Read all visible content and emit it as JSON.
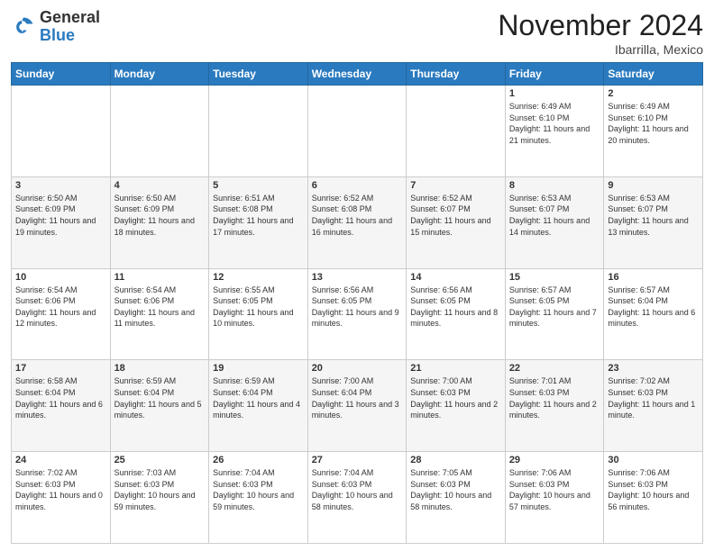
{
  "logo": {
    "general": "General",
    "blue": "Blue"
  },
  "header": {
    "month": "November 2024",
    "location": "Ibarrilla, Mexico"
  },
  "days_of_week": [
    "Sunday",
    "Monday",
    "Tuesday",
    "Wednesday",
    "Thursday",
    "Friday",
    "Saturday"
  ],
  "weeks": [
    [
      {
        "day": "",
        "sunrise": "",
        "sunset": "",
        "daylight": ""
      },
      {
        "day": "",
        "sunrise": "",
        "sunset": "",
        "daylight": ""
      },
      {
        "day": "",
        "sunrise": "",
        "sunset": "",
        "daylight": ""
      },
      {
        "day": "",
        "sunrise": "",
        "sunset": "",
        "daylight": ""
      },
      {
        "day": "",
        "sunrise": "",
        "sunset": "",
        "daylight": ""
      },
      {
        "day": "1",
        "sunrise": "Sunrise: 6:49 AM",
        "sunset": "Sunset: 6:10 PM",
        "daylight": "Daylight: 11 hours and 21 minutes."
      },
      {
        "day": "2",
        "sunrise": "Sunrise: 6:49 AM",
        "sunset": "Sunset: 6:10 PM",
        "daylight": "Daylight: 11 hours and 20 minutes."
      }
    ],
    [
      {
        "day": "3",
        "sunrise": "Sunrise: 6:50 AM",
        "sunset": "Sunset: 6:09 PM",
        "daylight": "Daylight: 11 hours and 19 minutes."
      },
      {
        "day": "4",
        "sunrise": "Sunrise: 6:50 AM",
        "sunset": "Sunset: 6:09 PM",
        "daylight": "Daylight: 11 hours and 18 minutes."
      },
      {
        "day": "5",
        "sunrise": "Sunrise: 6:51 AM",
        "sunset": "Sunset: 6:08 PM",
        "daylight": "Daylight: 11 hours and 17 minutes."
      },
      {
        "day": "6",
        "sunrise": "Sunrise: 6:52 AM",
        "sunset": "Sunset: 6:08 PM",
        "daylight": "Daylight: 11 hours and 16 minutes."
      },
      {
        "day": "7",
        "sunrise": "Sunrise: 6:52 AM",
        "sunset": "Sunset: 6:07 PM",
        "daylight": "Daylight: 11 hours and 15 minutes."
      },
      {
        "day": "8",
        "sunrise": "Sunrise: 6:53 AM",
        "sunset": "Sunset: 6:07 PM",
        "daylight": "Daylight: 11 hours and 14 minutes."
      },
      {
        "day": "9",
        "sunrise": "Sunrise: 6:53 AM",
        "sunset": "Sunset: 6:07 PM",
        "daylight": "Daylight: 11 hours and 13 minutes."
      }
    ],
    [
      {
        "day": "10",
        "sunrise": "Sunrise: 6:54 AM",
        "sunset": "Sunset: 6:06 PM",
        "daylight": "Daylight: 11 hours and 12 minutes."
      },
      {
        "day": "11",
        "sunrise": "Sunrise: 6:54 AM",
        "sunset": "Sunset: 6:06 PM",
        "daylight": "Daylight: 11 hours and 11 minutes."
      },
      {
        "day": "12",
        "sunrise": "Sunrise: 6:55 AM",
        "sunset": "Sunset: 6:05 PM",
        "daylight": "Daylight: 11 hours and 10 minutes."
      },
      {
        "day": "13",
        "sunrise": "Sunrise: 6:56 AM",
        "sunset": "Sunset: 6:05 PM",
        "daylight": "Daylight: 11 hours and 9 minutes."
      },
      {
        "day": "14",
        "sunrise": "Sunrise: 6:56 AM",
        "sunset": "Sunset: 6:05 PM",
        "daylight": "Daylight: 11 hours and 8 minutes."
      },
      {
        "day": "15",
        "sunrise": "Sunrise: 6:57 AM",
        "sunset": "Sunset: 6:05 PM",
        "daylight": "Daylight: 11 hours and 7 minutes."
      },
      {
        "day": "16",
        "sunrise": "Sunrise: 6:57 AM",
        "sunset": "Sunset: 6:04 PM",
        "daylight": "Daylight: 11 hours and 6 minutes."
      }
    ],
    [
      {
        "day": "17",
        "sunrise": "Sunrise: 6:58 AM",
        "sunset": "Sunset: 6:04 PM",
        "daylight": "Daylight: 11 hours and 6 minutes."
      },
      {
        "day": "18",
        "sunrise": "Sunrise: 6:59 AM",
        "sunset": "Sunset: 6:04 PM",
        "daylight": "Daylight: 11 hours and 5 minutes."
      },
      {
        "day": "19",
        "sunrise": "Sunrise: 6:59 AM",
        "sunset": "Sunset: 6:04 PM",
        "daylight": "Daylight: 11 hours and 4 minutes."
      },
      {
        "day": "20",
        "sunrise": "Sunrise: 7:00 AM",
        "sunset": "Sunset: 6:04 PM",
        "daylight": "Daylight: 11 hours and 3 minutes."
      },
      {
        "day": "21",
        "sunrise": "Sunrise: 7:00 AM",
        "sunset": "Sunset: 6:03 PM",
        "daylight": "Daylight: 11 hours and 2 minutes."
      },
      {
        "day": "22",
        "sunrise": "Sunrise: 7:01 AM",
        "sunset": "Sunset: 6:03 PM",
        "daylight": "Daylight: 11 hours and 2 minutes."
      },
      {
        "day": "23",
        "sunrise": "Sunrise: 7:02 AM",
        "sunset": "Sunset: 6:03 PM",
        "daylight": "Daylight: 11 hours and 1 minute."
      }
    ],
    [
      {
        "day": "24",
        "sunrise": "Sunrise: 7:02 AM",
        "sunset": "Sunset: 6:03 PM",
        "daylight": "Daylight: 11 hours and 0 minutes."
      },
      {
        "day": "25",
        "sunrise": "Sunrise: 7:03 AM",
        "sunset": "Sunset: 6:03 PM",
        "daylight": "Daylight: 10 hours and 59 minutes."
      },
      {
        "day": "26",
        "sunrise": "Sunrise: 7:04 AM",
        "sunset": "Sunset: 6:03 PM",
        "daylight": "Daylight: 10 hours and 59 minutes."
      },
      {
        "day": "27",
        "sunrise": "Sunrise: 7:04 AM",
        "sunset": "Sunset: 6:03 PM",
        "daylight": "Daylight: 10 hours and 58 minutes."
      },
      {
        "day": "28",
        "sunrise": "Sunrise: 7:05 AM",
        "sunset": "Sunset: 6:03 PM",
        "daylight": "Daylight: 10 hours and 58 minutes."
      },
      {
        "day": "29",
        "sunrise": "Sunrise: 7:06 AM",
        "sunset": "Sunset: 6:03 PM",
        "daylight": "Daylight: 10 hours and 57 minutes."
      },
      {
        "day": "30",
        "sunrise": "Sunrise: 7:06 AM",
        "sunset": "Sunset: 6:03 PM",
        "daylight": "Daylight: 10 hours and 56 minutes."
      }
    ]
  ]
}
